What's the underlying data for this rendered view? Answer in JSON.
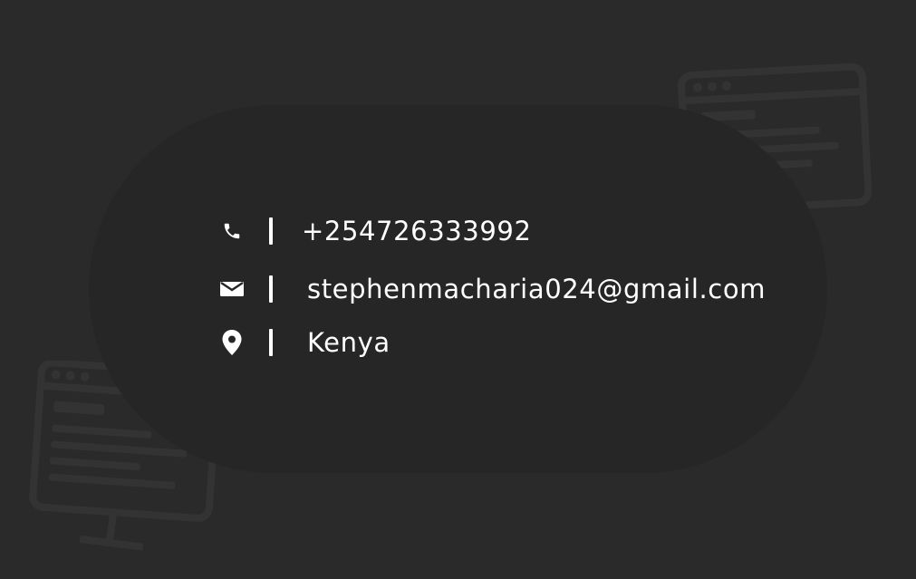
{
  "colors": {
    "background": "#2a2a2a",
    "card": "#262626",
    "text": "#ffffff",
    "decoration": "#3a3a3a"
  },
  "contact": {
    "phone": {
      "icon": "phone-icon",
      "separator": "|",
      "value": "+254726333992"
    },
    "email": {
      "icon": "mail-icon",
      "separator": "|",
      "value": "stephenmacharia024@gmail.com"
    },
    "location": {
      "icon": "location-pin-icon",
      "separator": "|",
      "value": "Kenya"
    }
  },
  "decorations": [
    {
      "icon": "code-window-icon"
    },
    {
      "icon": "code-monitor-icon"
    }
  ]
}
